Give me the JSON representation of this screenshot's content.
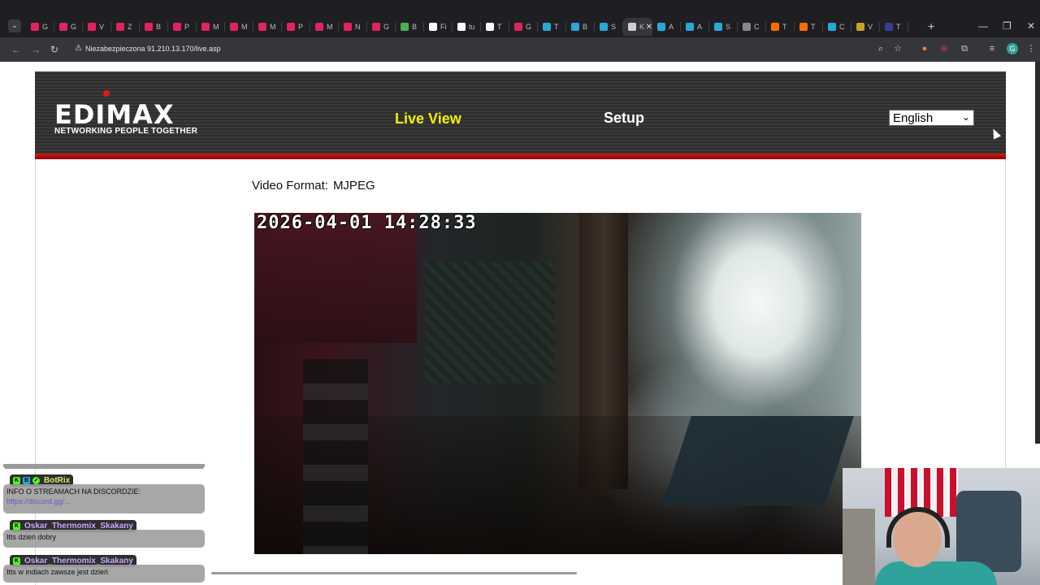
{
  "browser": {
    "tabs": [
      {
        "title": "G",
        "color": "#e0245e"
      },
      {
        "title": "G",
        "color": "#e0245e"
      },
      {
        "title": "V",
        "color": "#e0245e"
      },
      {
        "title": "Z",
        "color": "#e0245e"
      },
      {
        "title": "B",
        "color": "#e0245e"
      },
      {
        "title": "P",
        "color": "#e0245e"
      },
      {
        "title": "M",
        "color": "#e0245e"
      },
      {
        "title": "M",
        "color": "#e0245e"
      },
      {
        "title": "M",
        "color": "#e0245e"
      },
      {
        "title": "P",
        "color": "#e0245e"
      },
      {
        "title": "M",
        "color": "#e0245e"
      },
      {
        "title": "N",
        "color": "#e0245e"
      },
      {
        "title": "G",
        "color": "#e0245e"
      },
      {
        "title": "B",
        "color": "#4caf50"
      },
      {
        "title": "Fi",
        "color": "#ffffff"
      },
      {
        "title": "tu",
        "color": "#ffffff"
      },
      {
        "title": "T",
        "color": "#ffffff"
      },
      {
        "title": "G",
        "color": "#e0245e"
      },
      {
        "title": "T",
        "color": "#2aa8d8"
      },
      {
        "title": "B",
        "color": "#2aa8d8"
      },
      {
        "title": "S",
        "color": "#2aa8d8"
      },
      {
        "title": "K",
        "color": "#cfcfcf",
        "active": true
      },
      {
        "title": "A",
        "color": "#2aa8d8"
      },
      {
        "title": "A",
        "color": "#2aa8d8"
      },
      {
        "title": "S",
        "color": "#2aa8d8"
      },
      {
        "title": "C",
        "color": "#888888"
      },
      {
        "title": "T",
        "color": "#ff6d00"
      },
      {
        "title": "T",
        "color": "#ff6d00"
      },
      {
        "title": "C",
        "color": "#2aa8d8"
      },
      {
        "title": "V",
        "color": "#c9a227"
      },
      {
        "title": "T",
        "color": "#3b3b99"
      }
    ],
    "security_label": "Niezabezpieczona",
    "url": "91.210.13.170/live.asp"
  },
  "header": {
    "logo_text": "EDIMAX",
    "tagline": "NETWORKING PEOPLE TOGETHER",
    "nav_live": "Live View",
    "nav_setup": "Setup",
    "language": "English"
  },
  "main": {
    "video_format_label": "Video Format:",
    "video_format_value": "MJPEG",
    "timestamp": "2026-04-01 14:28:33"
  },
  "chat": {
    "messages": [
      {
        "user": "BotRix",
        "user_color": "#d8e86a",
        "text": "INFO O STREAMACH NA DISCORDZIE:",
        "link": "https://discord.gg/..."
      },
      {
        "user": "Oskar_Thermomix_Skakany",
        "user_color": "#c9a6ff",
        "text": "Itts dzień dobry"
      },
      {
        "user": "Oskar_Thermomix_Skakany",
        "user_color": "#c9a6ff",
        "text": "Itts w indiach zawsze jest dzień"
      }
    ]
  }
}
